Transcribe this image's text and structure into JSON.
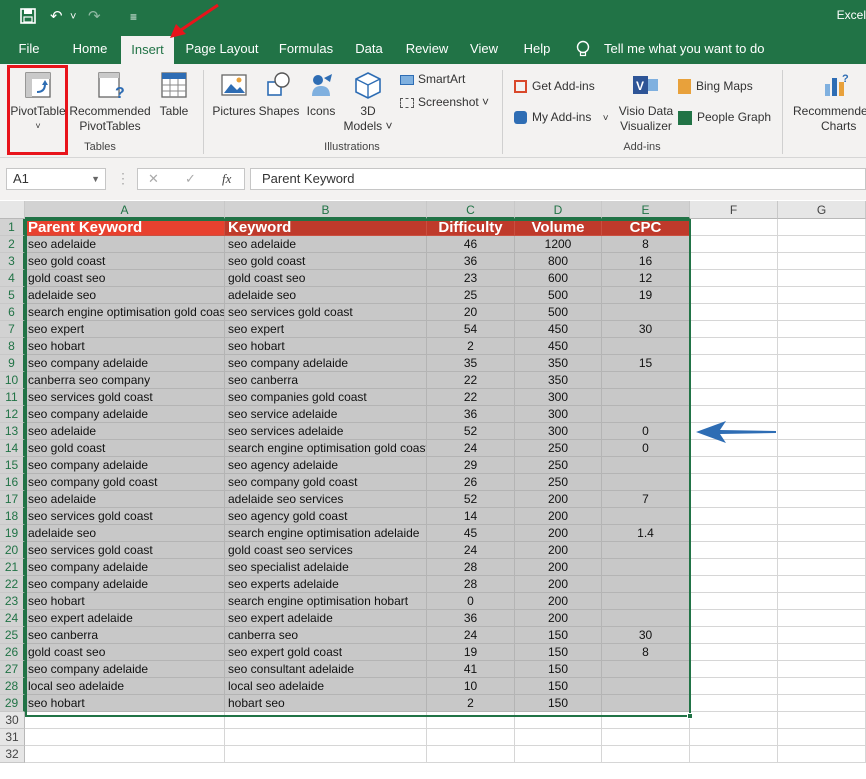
{
  "app": {
    "title": "Excel"
  },
  "quick_access": {
    "save": "💾",
    "undo": "↶",
    "undo_menu": "˅",
    "redo": "↷",
    "customize": "≡"
  },
  "tabs": [
    "File",
    "Home",
    "Insert",
    "Page Layout",
    "Formulas",
    "Data",
    "Review",
    "View",
    "Help"
  ],
  "tell_me": "Tell me what you want to do",
  "ribbon": {
    "pivot_table": "PivotTable",
    "recommended_pivot": [
      "Recommended",
      "PivotTables"
    ],
    "table": "Table",
    "group_tables": "Tables",
    "pictures": "Pictures",
    "shapes": "Shapes",
    "icons": "Icons",
    "models_3d": [
      "3D",
      "Models"
    ],
    "smartart": "SmartArt",
    "screenshot": "Screenshot",
    "group_illustrations": "Illustrations",
    "get_addins": "Get Add-ins",
    "my_addins": "My Add-ins",
    "visio": [
      "Visio Data",
      "Visualizer"
    ],
    "bing_maps": "Bing Maps",
    "people_graph": "People Graph",
    "group_addins": "Add-ins",
    "rec_charts": [
      "Recommended",
      "Charts"
    ]
  },
  "formula_bar": {
    "name_box": "A1",
    "fx": "fx",
    "cancel": "✕",
    "enter": "✓",
    "formula": "Parent Keyword"
  },
  "columns": [
    "A",
    "B",
    "C",
    "D",
    "E",
    "F",
    "G"
  ],
  "header": [
    "Parent Keyword",
    "Keyword",
    "Difficulty",
    "Volume",
    "CPC"
  ],
  "rows": [
    [
      "seo adelaide",
      "seo adelaide",
      "46",
      "1200",
      "8"
    ],
    [
      "seo gold coast",
      "seo gold coast",
      "36",
      "800",
      "16"
    ],
    [
      "gold coast seo",
      "gold coast seo",
      "23",
      "600",
      "12"
    ],
    [
      "adelaide seo",
      "adelaide seo",
      "25",
      "500",
      "19"
    ],
    [
      "search engine optimisation gold coast",
      "seo services gold coast",
      "20",
      "500",
      ""
    ],
    [
      "seo expert",
      "seo expert",
      "54",
      "450",
      "30"
    ],
    [
      "seo hobart",
      "seo hobart",
      "2",
      "450",
      ""
    ],
    [
      "seo company adelaide",
      "seo company adelaide",
      "35",
      "350",
      "15"
    ],
    [
      "canberra seo company",
      "seo canberra",
      "22",
      "350",
      ""
    ],
    [
      "seo services gold coast",
      "seo companies gold coast",
      "22",
      "300",
      ""
    ],
    [
      "seo company adelaide",
      "seo service adelaide",
      "36",
      "300",
      ""
    ],
    [
      "seo adelaide",
      "seo services adelaide",
      "52",
      "300",
      "0"
    ],
    [
      "seo gold coast",
      "search engine optimisation gold coast",
      "24",
      "250",
      "0"
    ],
    [
      "seo company adelaide",
      "seo agency adelaide",
      "29",
      "250",
      ""
    ],
    [
      "seo company gold coast",
      "seo company gold coast",
      "26",
      "250",
      ""
    ],
    [
      "seo adelaide",
      "adelaide seo services",
      "52",
      "200",
      "7"
    ],
    [
      "seo services gold coast",
      "seo agency gold coast",
      "14",
      "200",
      ""
    ],
    [
      "adelaide seo",
      "search engine optimisation adelaide",
      "45",
      "200",
      "1.4"
    ],
    [
      "seo services gold coast",
      "gold coast seo services",
      "24",
      "200",
      ""
    ],
    [
      "seo company adelaide",
      "seo specialist adelaide",
      "28",
      "200",
      ""
    ],
    [
      "seo company adelaide",
      "seo experts adelaide",
      "28",
      "200",
      ""
    ],
    [
      "seo hobart",
      "search engine optimisation hobart",
      "0",
      "200",
      ""
    ],
    [
      "seo expert adelaide",
      "seo expert adelaide",
      "36",
      "200",
      ""
    ],
    [
      "seo canberra",
      "canberra seo",
      "24",
      "150",
      "30"
    ],
    [
      "gold coast seo",
      "seo expert gold coast",
      "19",
      "150",
      "8"
    ],
    [
      "seo company adelaide",
      "seo consultant adelaide",
      "41",
      "150",
      ""
    ],
    [
      "local seo adelaide",
      "local seo adelaide",
      "10",
      "150",
      ""
    ],
    [
      "seo hobart",
      "hobart seo",
      "2",
      "150",
      ""
    ]
  ],
  "row_numbers": [
    "1",
    "2",
    "3",
    "4",
    "5",
    "6",
    "7",
    "8",
    "9",
    "10",
    "11",
    "12",
    "13",
    "14",
    "15",
    "16",
    "17",
    "18",
    "19",
    "20",
    "21",
    "22",
    "23",
    "24",
    "25",
    "26",
    "27",
    "28",
    "29",
    "30",
    "31",
    "32"
  ],
  "colors": {
    "excel_green": "#217346",
    "header_red": "#bf3a2b",
    "highlight_red": "#e8141b",
    "arrow_blue": "#2e6db4"
  }
}
